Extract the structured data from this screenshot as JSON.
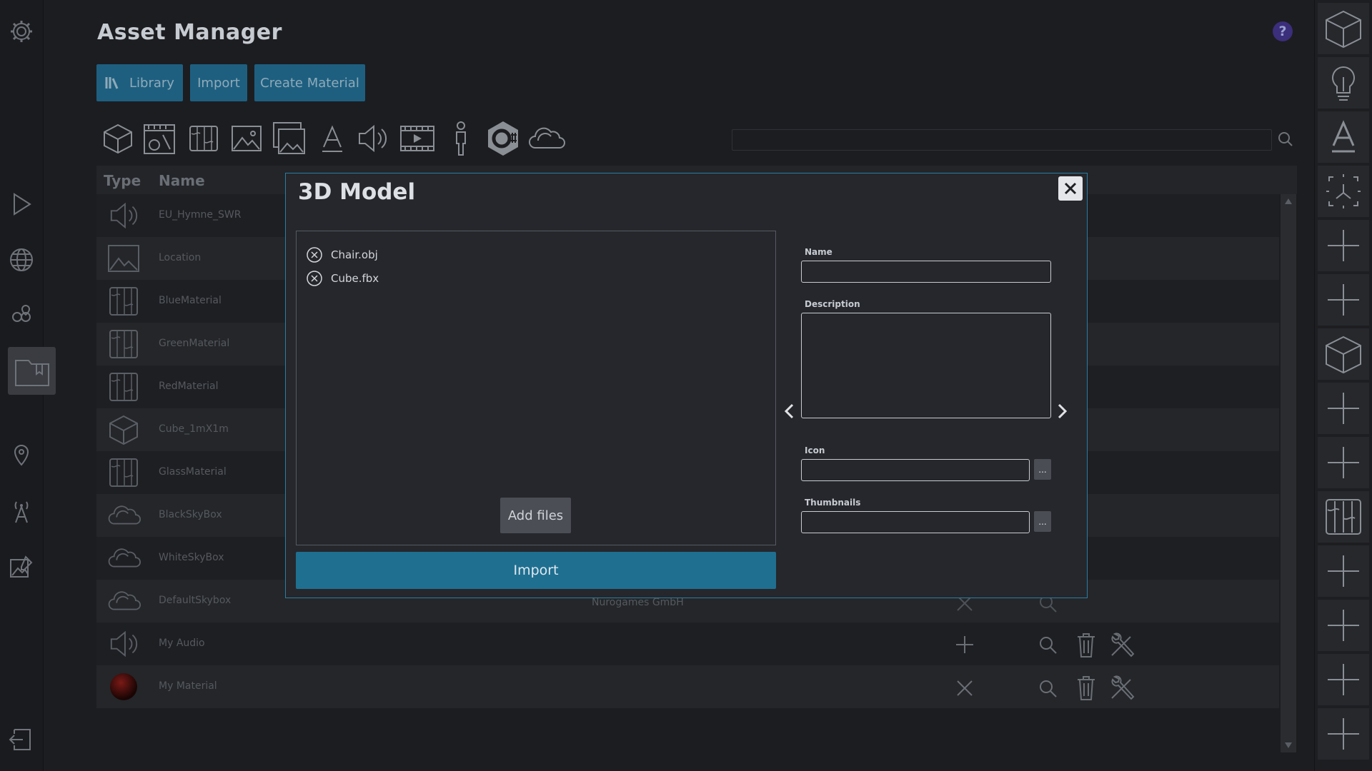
{
  "app": {
    "title": "Asset Manager",
    "help": "?"
  },
  "tabs": {
    "library": "Library",
    "import": "Import",
    "create_material": "Create Material"
  },
  "type_filters": [
    "3d-model-icon",
    "terrain-icon",
    "material-icon",
    "image-icon",
    "gallery-icon",
    "font-icon",
    "audio-icon",
    "video-icon",
    "avatar-icon",
    "script-icon",
    "skybox-icon"
  ],
  "table": {
    "headers": {
      "type": "Type",
      "name": "Name"
    },
    "rows": [
      {
        "icon": "audio-icon",
        "name": "EU_Hymne_SWR"
      },
      {
        "icon": "image-icon",
        "name": "Location"
      },
      {
        "icon": "material-icon",
        "name": "BlueMaterial"
      },
      {
        "icon": "material-icon",
        "name": "GreenMaterial"
      },
      {
        "icon": "material-icon",
        "name": "RedMaterial"
      },
      {
        "icon": "3d-model-icon",
        "name": "Cube_1mX1m"
      },
      {
        "icon": "material-icon",
        "name": "GlassMaterial"
      },
      {
        "icon": "skybox-icon",
        "name": "BlackSkyBox"
      },
      {
        "icon": "skybox-icon",
        "name": "WhiteSkyBox"
      },
      {
        "icon": "skybox-icon",
        "name": "DefaultSkybox",
        "owner": "Nurogames GmbH"
      },
      {
        "icon": "audio-icon",
        "name": "My Audio"
      },
      {
        "icon": "sphere-icon",
        "name": "My Material"
      }
    ]
  },
  "modal": {
    "title": "3D Model",
    "files": [
      "Chair.obj",
      "Cube.fbx"
    ],
    "add_files": "Add files",
    "import": "Import",
    "fields": {
      "name_label": "Name",
      "name_value": "",
      "description_label": "Description",
      "description_value": "",
      "icon_label": "Icon",
      "icon_value": "",
      "thumbnails_label": "Thumbnails",
      "thumbnails_value": "",
      "browse": "..."
    }
  },
  "colors": {
    "accent": "#1f6f90",
    "modal_border": "#2b7ea3",
    "background": "#1c1d20"
  }
}
